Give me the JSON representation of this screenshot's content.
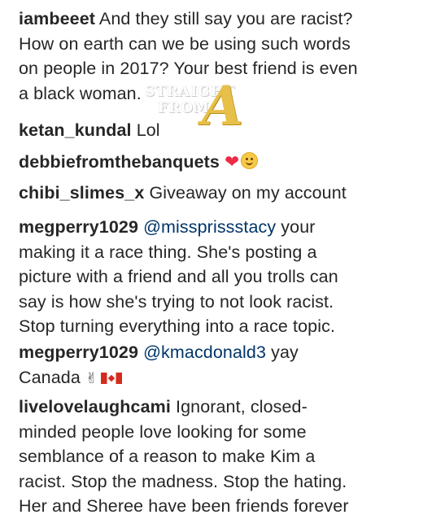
{
  "comments": [
    {
      "username": "iambeeet",
      "lines": [
        "And they still say you are racist?",
        "How on earth can we be using such words",
        "on people in 2017? Your best friend is even",
        "a black woman."
      ]
    },
    {
      "username": "ketan_kundal",
      "text": "Lol"
    },
    {
      "username": "debbiefromthebanquets",
      "emoji": [
        "red-heart",
        "smiling-face"
      ]
    },
    {
      "username": "chibi_slimes_x",
      "text": "Giveaway on my account"
    },
    {
      "username": "megperry1029",
      "mention": "@missprissstacy",
      "first_rest": "your",
      "lines": [
        "making it a race thing. She's posting a",
        "picture with a friend and all you trolls can",
        "say is how she's trying to not look racist.",
        "Stop turning everything into a race topic."
      ]
    },
    {
      "username": "megperry1029",
      "mention": "@kmacdonald3",
      "first_rest": "yay",
      "line2": "Canada",
      "emoji": [
        "victory-hand",
        "canada-flag"
      ]
    },
    {
      "username": "livelovelaughcami",
      "first_rest": "Ignorant, closed-",
      "lines": [
        "minded people love looking for some",
        "semblance of a reason to make Kim a",
        "racist. Stop the madness. Stop the hating.",
        "Her and Sheree have been friends forever"
      ]
    }
  ],
  "watermark": {
    "line1": "STRAIGHT",
    "line2": "FROM",
    "letter": "A"
  },
  "colors": {
    "text": "#262626",
    "mention": "#003569",
    "heart": "#ed2b47",
    "watermark_gold": "#e7c04a"
  }
}
